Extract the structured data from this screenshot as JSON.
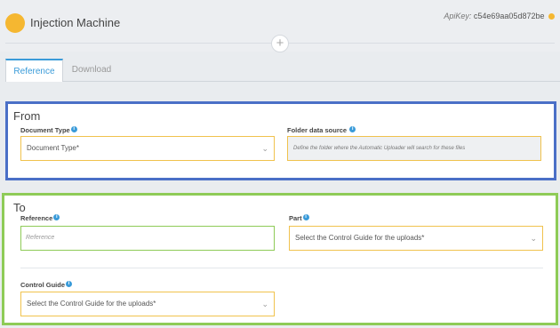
{
  "header": {
    "title": "Injection Machine",
    "apikey_label": "ApiKey:",
    "apikey_value": "c54e69aa05d872be",
    "add_symbol": "+",
    "colors": {
      "machine_dot": "#f5b731"
    }
  },
  "tabs": [
    {
      "label": "Reference",
      "active": true
    },
    {
      "label": "Download",
      "active": false
    }
  ],
  "from": {
    "title": "From",
    "document_type": {
      "label": "Document Type",
      "value": "Document Type*"
    },
    "folder_source": {
      "label": "Folder data source",
      "placeholder": "Define the folder where the Automatic Uploader will search for these files"
    },
    "border_color": "#4a6fc7"
  },
  "to": {
    "title": "To",
    "reference": {
      "label": "Reference",
      "placeholder": "Reference"
    },
    "part": {
      "label": "Part",
      "value": "Select the Control Guide for the uploads*"
    },
    "control_guide": {
      "label": "Control Guide",
      "value": "Select the Control Guide for the uploads*"
    },
    "border_color": "#8ecb57"
  }
}
